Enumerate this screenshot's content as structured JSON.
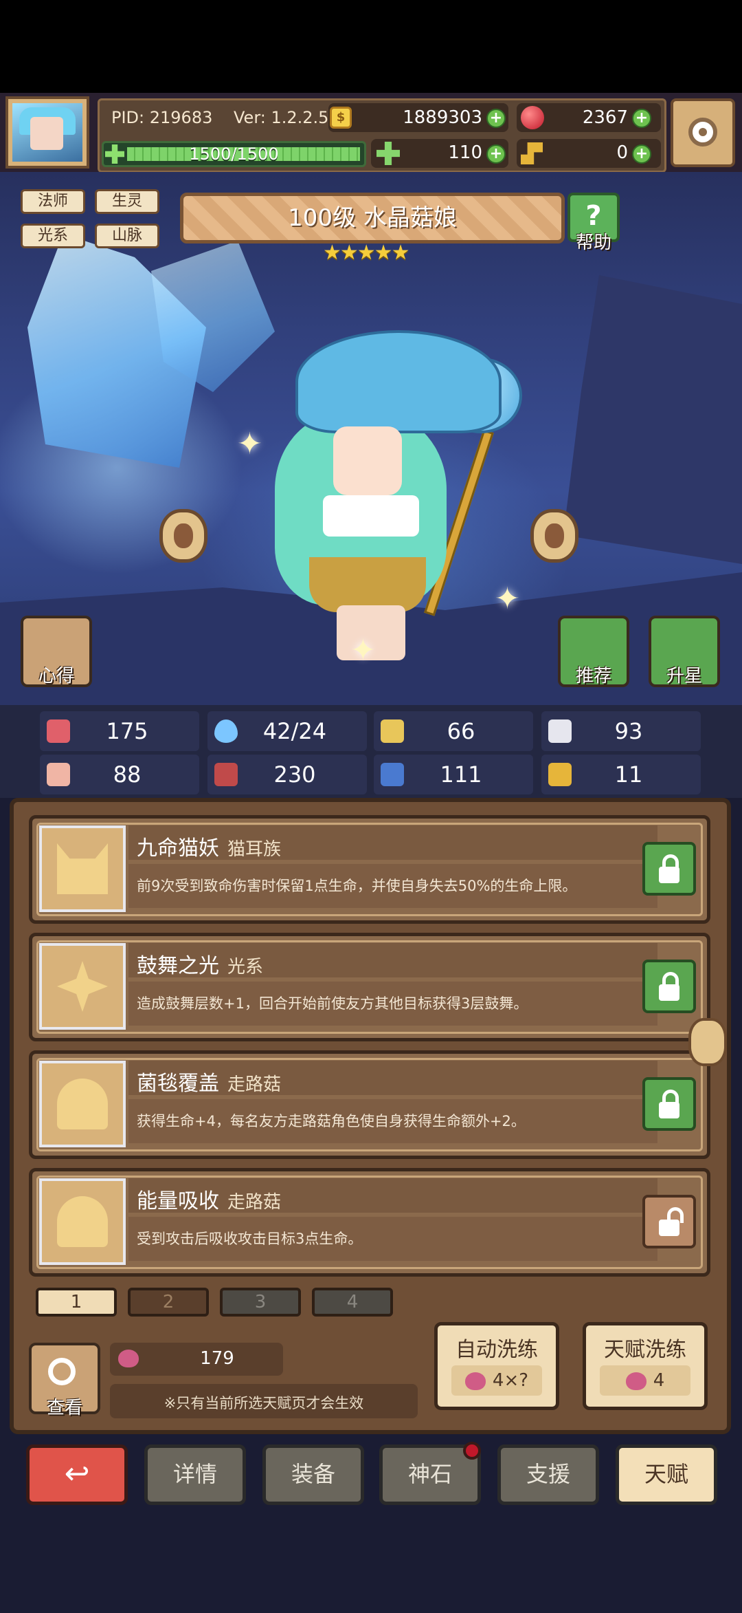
{
  "header": {
    "pid": "PID: 219683",
    "version": "Ver: 1.2.2.5",
    "gold": "1889303",
    "gems": "2367",
    "exp": "1500/1500",
    "clover": "110",
    "keys": "0"
  },
  "character": {
    "tags": [
      "法师",
      "生灵",
      "光系",
      "山脉"
    ],
    "title": "100级 水晶菇娘",
    "stars": "★★★★★",
    "help_label": "帮助",
    "notes_label": "心得",
    "recommend_label": "推荐",
    "star_up_label": "升星"
  },
  "stats": [
    {
      "icon": "heart-icon",
      "value": "175"
    },
    {
      "icon": "mana-drop-icon",
      "value": "42/24"
    },
    {
      "icon": "shield-icon",
      "value": "66"
    },
    {
      "icon": "wing-icon",
      "value": "93"
    },
    {
      "icon": "fist-icon",
      "value": "88"
    },
    {
      "icon": "book-icon",
      "value": "230"
    },
    {
      "icon": "stairs-icon",
      "value": "111"
    },
    {
      "icon": "horseshoe-icon",
      "value": "11"
    }
  ],
  "talents": [
    {
      "name": "九命猫妖",
      "type": "猫耳族",
      "desc": "前9次受到致命伤害时保留1点生命，并使自身失去50%的生命上限。",
      "icon": "cat-icon",
      "locked": true
    },
    {
      "name": "鼓舞之光",
      "type": "光系",
      "desc": "造成鼓舞层数+1，回合开始前使友方其他目标获得3层鼓舞。",
      "icon": "sun-icon",
      "locked": true
    },
    {
      "name": "菌毯覆盖",
      "type": "走路菇",
      "desc": "获得生命+4，每名友方走路菇角色使自身获得生命额外+2。",
      "icon": "mushroom-icon",
      "locked": true
    },
    {
      "name": "能量吸收",
      "type": "走路菇",
      "desc": "受到攻击后吸收攻击目标3点生命。",
      "icon": "mushroom-icon",
      "locked": false
    }
  ],
  "pages": [
    "1",
    "2",
    "3",
    "4"
  ],
  "footer": {
    "view_label": "查看",
    "peach_count": "179",
    "note": "※只有当前所选天赋页才会生效",
    "auto_reroll_label": "自动洗练",
    "auto_reroll_cost": "4×?",
    "reroll_label": "天赋洗练",
    "reroll_cost": "4"
  },
  "nav": {
    "details": "详情",
    "equipment": "装备",
    "godstone": "神石",
    "support": "支援",
    "talent": "天赋"
  },
  "colors": {
    "accent_green": "#5aa650",
    "panel_brown": "#6f4f36",
    "nav_red": "#e0544a"
  }
}
